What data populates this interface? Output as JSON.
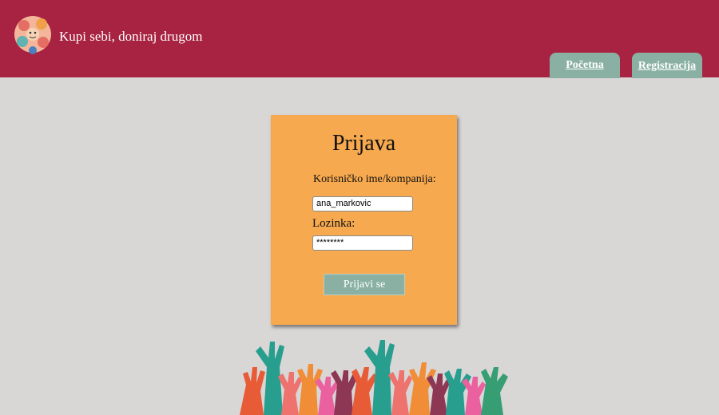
{
  "header": {
    "site_title": "Kupi sebi, doniraj drugom",
    "nav": [
      {
        "label": "Početna"
      },
      {
        "label": "Registracija"
      }
    ]
  },
  "login": {
    "title": "Prijava",
    "username_label": "Korisničko ime/kompanija:",
    "username_value": "ana_markovic",
    "password_label": "Lozinka:",
    "password_value": "********",
    "submit_label": "Prijavi se"
  },
  "colors": {
    "header_bg": "#a82341",
    "page_bg": "#d9d6d6",
    "card_bg": "#f6a94e",
    "accent": "#89b0a3"
  },
  "icons": {
    "logo": "children-logo-icon",
    "footer_image": "raised-hands-illustration"
  }
}
